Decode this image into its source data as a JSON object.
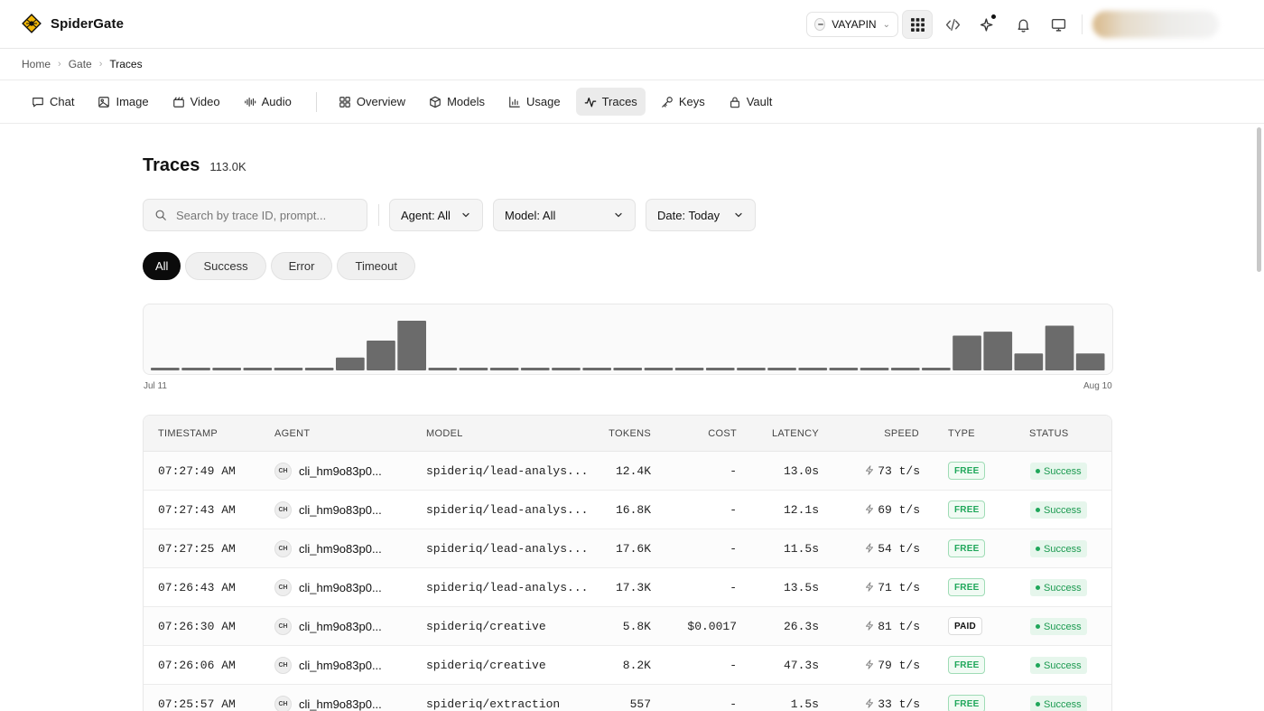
{
  "app": {
    "name": "SpiderGate"
  },
  "header": {
    "org_name": "VAYAPIN",
    "icons": [
      "apps-grid-icon",
      "code-icon",
      "sparkle-icon",
      "bell-icon",
      "monitor-icon"
    ]
  },
  "breadcrumb": [
    "Home",
    "Gate",
    "Traces"
  ],
  "nav": {
    "group1": [
      {
        "label": "Chat",
        "icon": "chat-icon"
      },
      {
        "label": "Image",
        "icon": "image-icon"
      },
      {
        "label": "Video",
        "icon": "video-icon"
      },
      {
        "label": "Audio",
        "icon": "audio-icon"
      }
    ],
    "group2": [
      {
        "label": "Overview",
        "icon": "grid-icon"
      },
      {
        "label": "Models",
        "icon": "cube-icon"
      },
      {
        "label": "Usage",
        "icon": "bar-chart-icon"
      },
      {
        "label": "Traces",
        "icon": "activity-icon",
        "active": true
      },
      {
        "label": "Keys",
        "icon": "key-icon"
      },
      {
        "label": "Vault",
        "icon": "lock-icon"
      }
    ]
  },
  "page": {
    "title": "Traces",
    "count": "113.0K"
  },
  "filters": {
    "search_placeholder": "Search by trace ID, prompt...",
    "agent": "Agent: All",
    "model": "Model: All",
    "date": "Date: Today"
  },
  "status_pills": [
    {
      "label": "All",
      "active": true
    },
    {
      "label": "Success"
    },
    {
      "label": "Error"
    },
    {
      "label": "Timeout"
    }
  ],
  "chart_data": {
    "type": "bar",
    "x_start_label": "Jul 11",
    "x_end_label": "Aug 10",
    "values": [
      0,
      0,
      0,
      0,
      0,
      0,
      13,
      30,
      50,
      0,
      0,
      0,
      0,
      0,
      0,
      0,
      0,
      0,
      0,
      0,
      0,
      0,
      0,
      0,
      0,
      0,
      35,
      39,
      17,
      45,
      17
    ],
    "bar_color": "#6b6b6b"
  },
  "table": {
    "columns": [
      "TIMESTAMP",
      "AGENT",
      "MODEL",
      "TOKENS",
      "COST",
      "LATENCY",
      "SPEED",
      "TYPE",
      "STATUS"
    ],
    "rows": [
      {
        "timestamp": "07:27:49 AM",
        "agent_initials": "CH",
        "agent": "cli_hm9o83p0...",
        "model": "spideriq/lead-analys...",
        "tokens": "12.4K",
        "cost": "-",
        "latency": "13.0s",
        "speed": "73 t/s",
        "type": "FREE",
        "status": "Success"
      },
      {
        "timestamp": "07:27:43 AM",
        "agent_initials": "CH",
        "agent": "cli_hm9o83p0...",
        "model": "spideriq/lead-analys...",
        "tokens": "16.8K",
        "cost": "-",
        "latency": "12.1s",
        "speed": "69 t/s",
        "type": "FREE",
        "status": "Success"
      },
      {
        "timestamp": "07:27:25 AM",
        "agent_initials": "CH",
        "agent": "cli_hm9o83p0...",
        "model": "spideriq/lead-analys...",
        "tokens": "17.6K",
        "cost": "-",
        "latency": "11.5s",
        "speed": "54 t/s",
        "type": "FREE",
        "status": "Success"
      },
      {
        "timestamp": "07:26:43 AM",
        "agent_initials": "CH",
        "agent": "cli_hm9o83p0...",
        "model": "spideriq/lead-analys...",
        "tokens": "17.3K",
        "cost": "-",
        "latency": "13.5s",
        "speed": "71 t/s",
        "type": "FREE",
        "status": "Success"
      },
      {
        "timestamp": "07:26:30 AM",
        "agent_initials": "CH",
        "agent": "cli_hm9o83p0...",
        "model": "spideriq/creative",
        "tokens": "5.8K",
        "cost": "$0.0017",
        "latency": "26.3s",
        "speed": "81 t/s",
        "type": "PAID",
        "status": "Success"
      },
      {
        "timestamp": "07:26:06 AM",
        "agent_initials": "CH",
        "agent": "cli_hm9o83p0...",
        "model": "spideriq/creative",
        "tokens": "8.2K",
        "cost": "-",
        "latency": "47.3s",
        "speed": "79 t/s",
        "type": "FREE",
        "status": "Success"
      },
      {
        "timestamp": "07:25:57 AM",
        "agent_initials": "CH",
        "agent": "cli_hm9o83p0...",
        "model": "spideriq/extraction",
        "tokens": "557",
        "cost": "-",
        "latency": "1.5s",
        "speed": "33 t/s",
        "type": "FREE",
        "status": "Success"
      }
    ]
  }
}
